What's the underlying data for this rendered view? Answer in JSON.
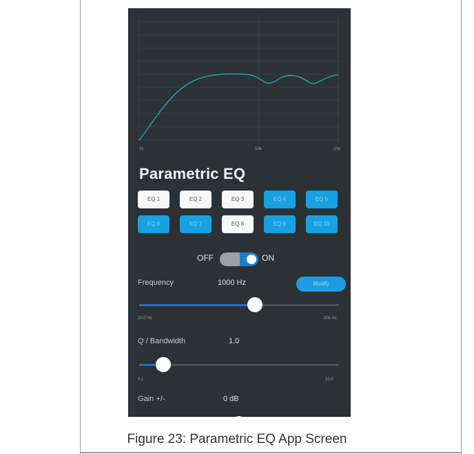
{
  "graph": {
    "x_labels": [
      "1k",
      "10k",
      "20k"
    ],
    "colors": {
      "grid": "#454d51",
      "curve": "#2b9aa8"
    }
  },
  "title": "Parametric EQ",
  "eq_buttons": [
    {
      "label": "EQ 1",
      "state": "white"
    },
    {
      "label": "EQ 2",
      "state": "white"
    },
    {
      "label": "EQ 3",
      "state": "white"
    },
    {
      "label": "EQ 4",
      "state": "blue"
    },
    {
      "label": "EQ 5",
      "state": "blue"
    },
    {
      "label": "EQ 6",
      "state": "blue"
    },
    {
      "label": "EQ 7",
      "state": "blue"
    },
    {
      "label": "EQ 8",
      "state": "white"
    },
    {
      "label": "EQ 9",
      "state": "blue"
    },
    {
      "label": "EQ 10",
      "state": "blue"
    }
  ],
  "toggle": {
    "off_label": "OFF",
    "on_label": "ON",
    "value": "on"
  },
  "frequency": {
    "label": "Frequency",
    "value": "1000 Hz",
    "modify_label": "Modify",
    "min_label": "20.0 Hz",
    "max_label": "20k Hz",
    "position": 0.58
  },
  "q": {
    "label": "Q / Bandwidth",
    "value": "1.0",
    "min_label": "0.1",
    "max_label": "10.0",
    "position": 0.12
  },
  "gain": {
    "label": "Gain +/-",
    "value": "0 dB",
    "position": 0.5
  },
  "caption": "Figure 23: Parametric EQ App Screen"
}
